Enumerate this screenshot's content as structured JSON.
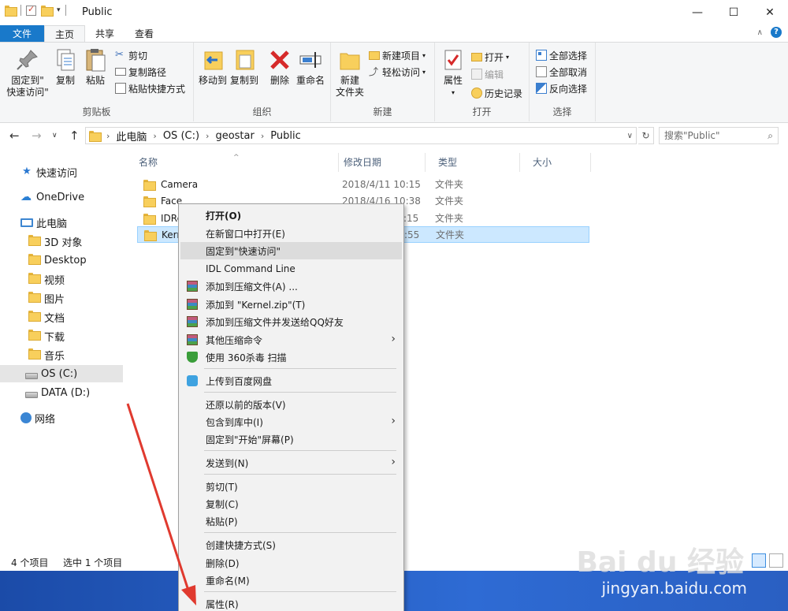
{
  "window": {
    "title": "Public",
    "minimize": "—",
    "maximize": "☐",
    "close": "✕"
  },
  "ribbon_tabs": [
    "文件",
    "主页",
    "共享",
    "查看"
  ],
  "ribbon": {
    "clipboard": {
      "label": "剪贴板",
      "pin": "固定到\"\n快速访问\"",
      "pin_line1": "固定到\"",
      "pin_line2": "快速访问\"",
      "copy": "复制",
      "paste": "粘贴",
      "cut": "剪切",
      "copy_path": "复制路径",
      "paste_shortcut": "粘贴快捷方式"
    },
    "organize": {
      "label": "组织",
      "move_to": "移动到",
      "copy_to": "复制到",
      "delete": "删除",
      "rename": "重命名"
    },
    "new": {
      "label": "新建",
      "new_folder_line1": "新建",
      "new_folder_line2": "文件夹",
      "new_item": "新建项目",
      "easy_access": "轻松访问"
    },
    "open": {
      "label": "打开",
      "properties": "属性",
      "open": "打开",
      "edit": "编辑",
      "history": "历史记录"
    },
    "select": {
      "label": "选择",
      "select_all": "全部选择",
      "select_none": "全部取消",
      "invert": "反向选择"
    }
  },
  "address": {
    "crumbs": [
      "此电脑",
      "OS (C:)",
      "geostar",
      "Public"
    ],
    "search_placeholder": "搜索\"Public\""
  },
  "navpane": [
    {
      "label": "快速访问",
      "icon": "star-icon"
    },
    {
      "label": "OneDrive",
      "icon": "cloud-icon"
    },
    {
      "label": "此电脑",
      "icon": "computer-icon"
    },
    {
      "label": "3D 对象",
      "icon": "folder-icon"
    },
    {
      "label": "Desktop",
      "icon": "folder-icon"
    },
    {
      "label": "视频",
      "icon": "folder-icon"
    },
    {
      "label": "图片",
      "icon": "folder-icon"
    },
    {
      "label": "文档",
      "icon": "folder-icon"
    },
    {
      "label": "下载",
      "icon": "folder-icon"
    },
    {
      "label": "音乐",
      "icon": "folder-icon"
    },
    {
      "label": "OS (C:)",
      "icon": "drive-icon"
    },
    {
      "label": "DATA (D:)",
      "icon": "drive-icon"
    },
    {
      "label": "网络",
      "icon": "network-icon"
    }
  ],
  "columns": [
    "名称",
    "修改日期",
    "类型",
    "大小"
  ],
  "files": [
    {
      "name": "Camera",
      "date": "2018/4/11 10:15",
      "type": "文件夹"
    },
    {
      "name": "Face",
      "date": "2018/4/16 10:38",
      "type": "文件夹"
    },
    {
      "name": "IDRe",
      "date": ":15",
      "type": "文件夹"
    },
    {
      "name": "Kern",
      "date": ":55",
      "type": "文件夹"
    }
  ],
  "status": {
    "count": "4 个项目",
    "selected": "选中 1 个项目"
  },
  "context_menu": [
    {
      "label": "打开(O)",
      "bold": true
    },
    {
      "label": "在新窗口中打开(E)"
    },
    {
      "label": "固定到\"快速访问\"",
      "hover": true
    },
    {
      "label": "IDL Command Line"
    },
    {
      "label": "添加到压缩文件(A) ...",
      "icon": "zip"
    },
    {
      "label": "添加到 \"Kernel.zip\"(T)",
      "icon": "zip"
    },
    {
      "label": "添加到压缩文件并发送给QQ好友",
      "icon": "zip"
    },
    {
      "label": "其他压缩命令",
      "icon": "zip",
      "submenu": true
    },
    {
      "label": "使用 360杀毒 扫描",
      "icon": "shield"
    },
    {
      "label": "上传到百度网盘",
      "icon": "baidu"
    },
    {
      "label": "还原以前的版本(V)"
    },
    {
      "label": "包含到库中(I)",
      "submenu": true
    },
    {
      "label": "固定到\"开始\"屏幕(P)"
    },
    {
      "label": "发送到(N)",
      "submenu": true
    },
    {
      "label": "剪切(T)"
    },
    {
      "label": "复制(C)"
    },
    {
      "label": "粘贴(P)"
    },
    {
      "label": "创建快捷方式(S)"
    },
    {
      "label": "删除(D)"
    },
    {
      "label": "重命名(M)"
    },
    {
      "label": "属性(R)"
    }
  ],
  "watermark": {
    "logo": "Bai du 经验",
    "url": "jingyan.baidu.com"
  },
  "colors": {
    "file_tab": "#1979ca",
    "selection": "#cce8ff",
    "annotation_arrow": "#e03a2f"
  }
}
